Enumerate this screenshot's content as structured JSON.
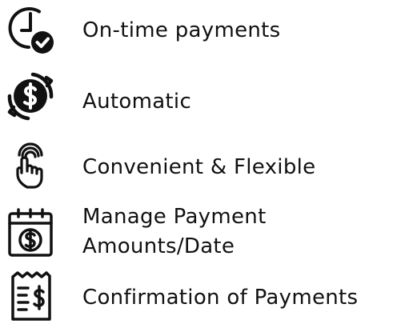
{
  "features": [
    {
      "icon": "clock-check-icon",
      "label": "On-time payments"
    },
    {
      "icon": "dollar-cycle-icon",
      "label": "Automatic"
    },
    {
      "icon": "touch-finger-icon",
      "label": "Convenient & Flexible"
    },
    {
      "icon": "calendar-dollar-icon",
      "label_line1": "Manage Payment",
      "label_line2": "Amounts/Date"
    },
    {
      "icon": "receipt-dollar-icon",
      "label": "Confirmation of Payments"
    }
  ],
  "colors": {
    "icon": "#111111",
    "text": "#111111",
    "background": "#ffffff"
  }
}
